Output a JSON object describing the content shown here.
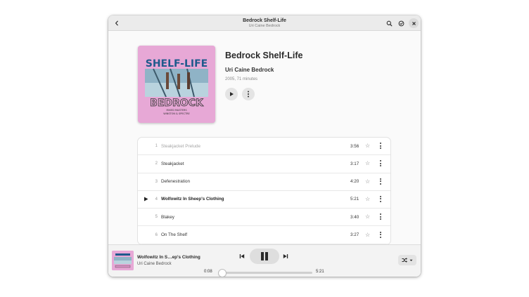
{
  "header": {
    "title": "Bedrock Shelf-Life",
    "subtitle": "Uri Caine Bedrock",
    "back_icon": "back-arrow-icon",
    "search_icon": "search-icon",
    "select_icon": "check-circle-icon",
    "close_icon": "close-icon"
  },
  "album": {
    "title": "Bedrock Shelf-Life",
    "artist": "Uri Caine Bedrock",
    "meta": "2005, 71 minutes",
    "cover": {
      "top_text": "SHELF-LIFE",
      "bottom_text": "BEDROCK",
      "small_text_1": "MIXED MASTERS",
      "small_text_2": "WINSTON & SPECTRE",
      "background_color": "#e7a8d6"
    },
    "play_icon": "play-icon",
    "menu_icon": "more-vertical-icon"
  },
  "tracks": [
    {
      "number": "1",
      "title": "Steakjacket Prelude",
      "duration": "3:56",
      "state": "played"
    },
    {
      "number": "2",
      "title": "Steakjacket",
      "duration": "3:17",
      "state": "normal"
    },
    {
      "number": "3",
      "title": "Defenestration",
      "duration": "4:20",
      "state": "normal"
    },
    {
      "number": "4",
      "title": "Wolfowitz In Sheep's Clothing",
      "duration": "5:21",
      "state": "playing"
    },
    {
      "number": "5",
      "title": "Blakey",
      "duration": "3:40",
      "state": "normal"
    },
    {
      "number": "6",
      "title": "On The Shelf",
      "duration": "3:27",
      "state": "normal"
    }
  ],
  "player": {
    "title": "Wolfowitz In S…ep's Clothing",
    "artist": "Uri Caine Bedrock",
    "elapsed": "0:08",
    "total": "5:21",
    "progress_fraction": 0.025,
    "prev_icon": "skip-previous-icon",
    "pause_icon": "pause-icon",
    "next_icon": "skip-next-icon",
    "shuffle_icon": "shuffle-icon",
    "dropdown_icon": "chevron-down-icon"
  },
  "colors": {
    "accent_cover": "#e7a8d6",
    "window_bg": "#fafafa",
    "headerbar_bg": "#ebebeb"
  }
}
